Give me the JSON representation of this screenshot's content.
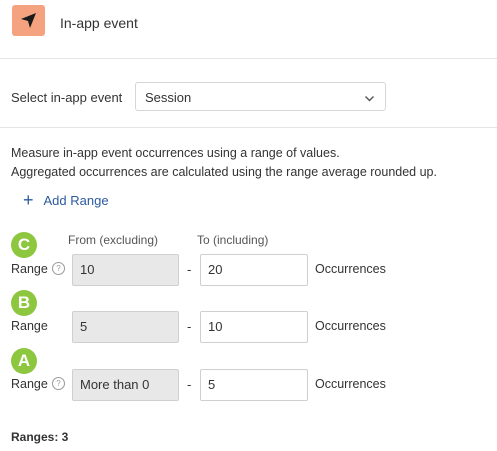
{
  "header": {
    "title": "In-app event",
    "icon": "navigation-arrow-icon",
    "icon_bg": "#f4a27f"
  },
  "event_select": {
    "label": "Select in-app event",
    "value": "Session"
  },
  "description": {
    "line1": "Measure in-app event occurrences using a range of values.",
    "line2": "Aggregated occurrences are calculated using the range average rounded up."
  },
  "add_range_label": "Add Range",
  "columns": {
    "from": "From (excluding)",
    "to": "To (including)"
  },
  "badge_color": "#8dc63f",
  "ranges": [
    {
      "badge": "C",
      "label": "Range",
      "has_help": true,
      "from": "10",
      "to": "20",
      "unit": "Occurrences"
    },
    {
      "badge": "B",
      "label": "Range",
      "has_help": false,
      "from": "5",
      "to": "10",
      "unit": "Occurrences"
    },
    {
      "badge": "A",
      "label": "Range",
      "has_help": true,
      "from": "More than 0",
      "to": "5",
      "unit": "Occurrences"
    }
  ],
  "ranges_count": "Ranges: 3"
}
